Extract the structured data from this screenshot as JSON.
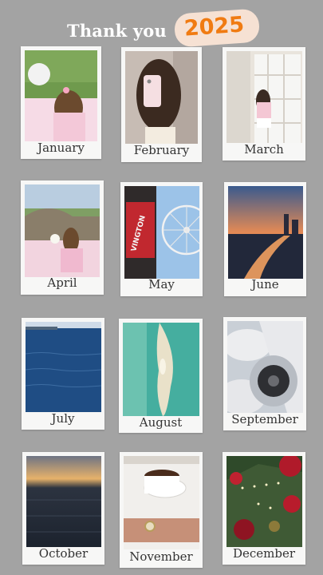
{
  "header": {
    "title": "Thank you",
    "year": "2025"
  },
  "months": [
    {
      "label": "January"
    },
    {
      "label": "February"
    },
    {
      "label": "March"
    },
    {
      "label": "April"
    },
    {
      "label": "May"
    },
    {
      "label": "June"
    },
    {
      "label": "July"
    },
    {
      "label": "August"
    },
    {
      "label": "September"
    },
    {
      "label": "October"
    },
    {
      "label": "November"
    },
    {
      "label": "December"
    }
  ],
  "photos": {
    "may_sign": "VINGTON"
  },
  "colors": {
    "background": "#a3a3a3",
    "frame": "#f7f7f6",
    "year_pill": "#f6e1d3",
    "year_text": "#f07b12"
  }
}
